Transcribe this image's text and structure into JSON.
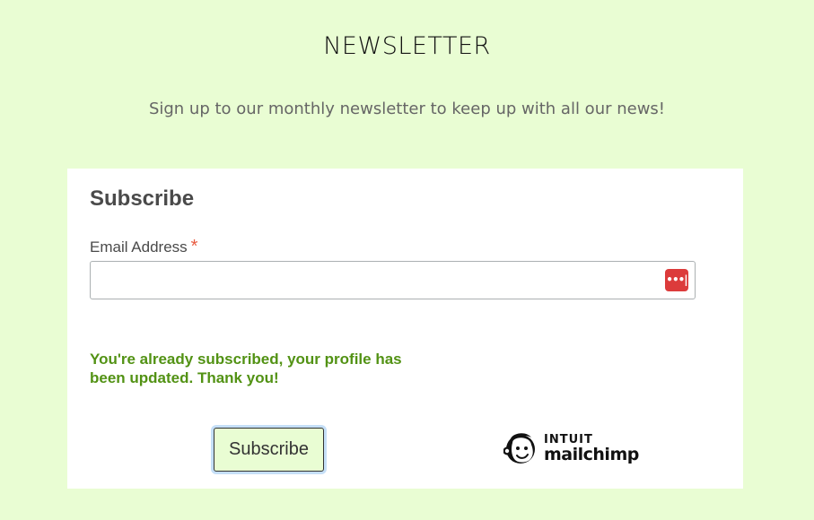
{
  "header": {
    "title": "NEWSLETTER",
    "subtitle": "Sign up to our monthly newsletter to keep up with all our news!"
  },
  "form": {
    "heading": "Subscribe",
    "email_label": "Email Address",
    "required_marker": "*",
    "email_value": "",
    "password_manager_icon": "password-manager-icon",
    "success_message": "You're already subscribed, your profile has been updated. Thank you!",
    "subscribe_label": "Subscribe"
  },
  "badge": {
    "brand_top": "INTUIT",
    "brand_bottom": "mailchimp",
    "icon": "freddie-icon"
  },
  "colors": {
    "page_background": "#e9fdd3",
    "success_text": "#529214",
    "required_star": "#e85c41",
    "password_manager": "#dc3b3b"
  }
}
